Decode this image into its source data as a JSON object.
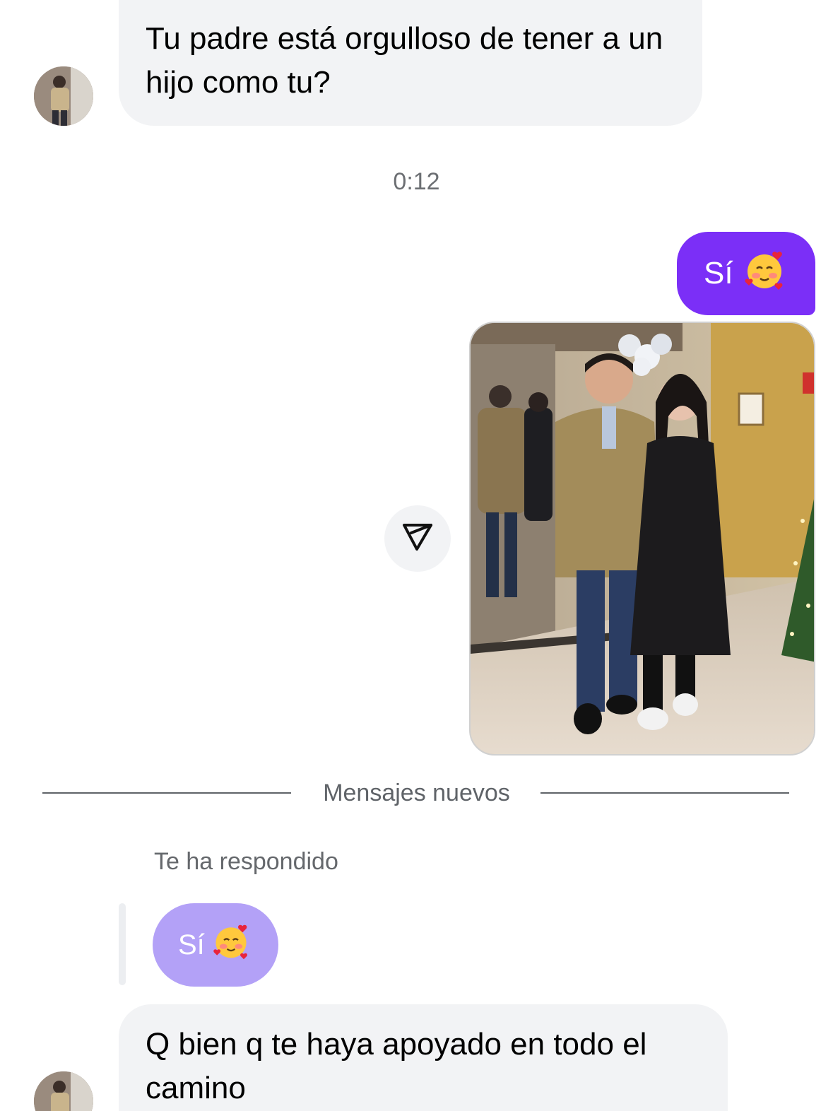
{
  "messages": {
    "incoming_1": "Tu padre está orgulloso de tener a un hijo como tu?",
    "timestamp": "0:12",
    "outgoing_reply": "Sí",
    "outgoing_emoji": "smiling-face-with-hearts",
    "new_messages_label": "Mensajes nuevos",
    "reply_note": "Te ha respondido",
    "reply_quote": "Sí",
    "incoming_2": "Q bien q te haya apoyado en todo el camino"
  },
  "colors": {
    "outgoing_bubble": "#7b2ff7",
    "incoming_bubble": "#f2f3f5",
    "reply_quote_bubble": "#b3a1f7"
  }
}
